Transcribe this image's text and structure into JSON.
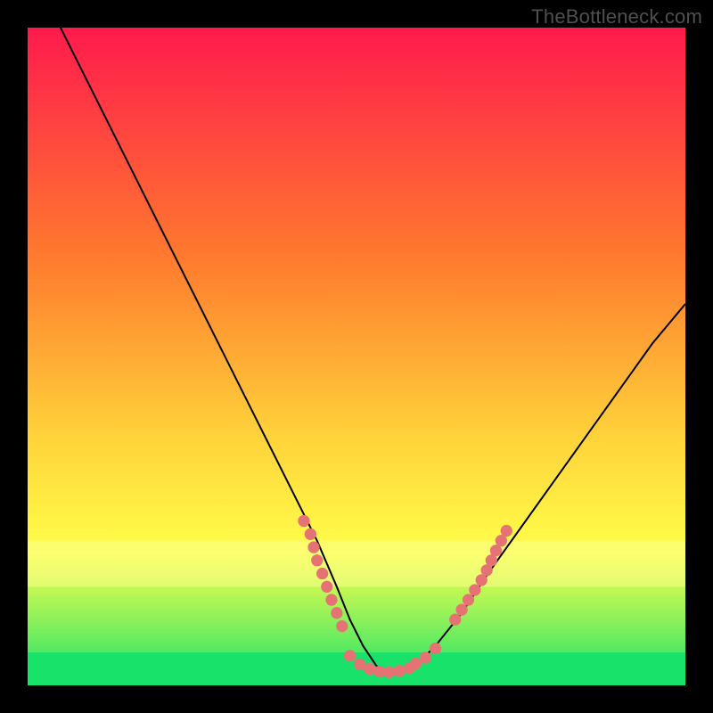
{
  "watermark": "TheBottleneck.com",
  "gradient": {
    "top": "#ff1a4d",
    "mid1": "#ff7a2e",
    "mid2": "#ffd23a",
    "low": "#ffff4a",
    "band": "#faff8e",
    "bottom": "#19e26b"
  },
  "curve_color": "#000000",
  "dot_color": "#e57373",
  "chart_data": {
    "type": "line",
    "title": "",
    "xlabel": "",
    "ylabel": "",
    "xlim": [
      0,
      100
    ],
    "ylim": [
      0,
      100
    ],
    "series": [
      {
        "name": "bottleneck-curve",
        "x": [
          5,
          8,
          12,
          16,
          20,
          24,
          28,
          32,
          36,
          40,
          44,
          47,
          49,
          51,
          53,
          55,
          57,
          59,
          62,
          66,
          70,
          75,
          80,
          85,
          90,
          95,
          100
        ],
        "y": [
          100,
          94,
          86,
          78,
          70,
          62,
          54,
          46,
          38,
          30,
          22,
          15,
          10,
          6,
          3,
          2,
          2,
          3,
          6,
          11,
          17,
          24,
          31,
          38,
          45,
          52,
          58
        ]
      }
    ],
    "dot_clusters": [
      {
        "name": "left-cluster",
        "points": [
          [
            42,
            25
          ],
          [
            43,
            23
          ],
          [
            43.5,
            21
          ],
          [
            44,
            19
          ],
          [
            44.8,
            17
          ],
          [
            45.5,
            15
          ],
          [
            46.2,
            13
          ],
          [
            47,
            11
          ],
          [
            47.8,
            9
          ]
        ]
      },
      {
        "name": "valley-cluster",
        "points": [
          [
            49,
            4.5
          ],
          [
            50.5,
            3.2
          ],
          [
            52,
            2.5
          ],
          [
            53.5,
            2.1
          ],
          [
            55,
            2
          ],
          [
            56.5,
            2.2
          ],
          [
            58,
            2.6
          ],
          [
            59,
            3.3
          ],
          [
            60.5,
            4.2
          ],
          [
            62,
            5.6
          ]
        ]
      },
      {
        "name": "right-cluster",
        "points": [
          [
            65,
            10
          ],
          [
            66,
            11.5
          ],
          [
            67,
            13
          ],
          [
            68,
            14.5
          ],
          [
            69,
            16
          ],
          [
            69.8,
            17.5
          ],
          [
            70.5,
            19
          ],
          [
            71.2,
            20.5
          ],
          [
            72,
            22
          ],
          [
            72.8,
            23.5
          ]
        ]
      }
    ],
    "pale_band": {
      "y0": 15,
      "y1": 22
    },
    "green_band": {
      "y0": 0,
      "y1": 5
    }
  }
}
